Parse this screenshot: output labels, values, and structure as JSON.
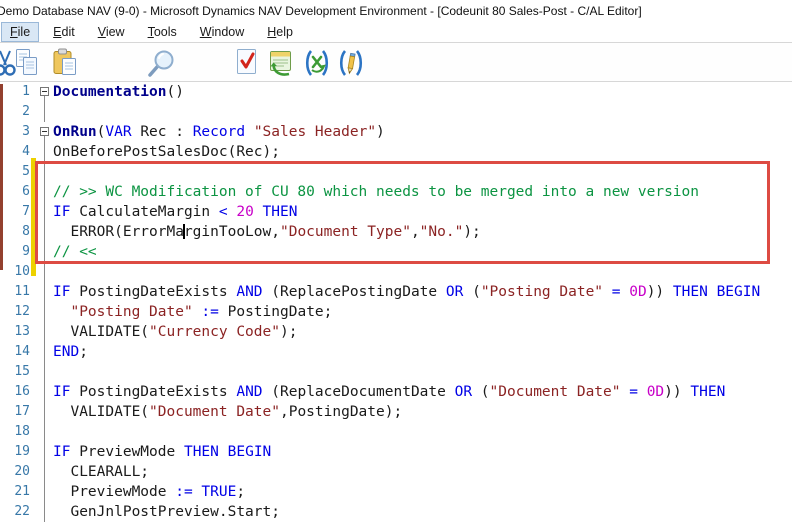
{
  "window": {
    "title": "Demo Database NAV (9-0) - Microsoft Dynamics NAV Development Environment - [Codeunit 80 Sales-Post - C/AL Editor]"
  },
  "menu": {
    "items": [
      {
        "label": "File",
        "mnemonic": "F",
        "active": true
      },
      {
        "label": "Edit",
        "mnemonic": "E",
        "active": false
      },
      {
        "label": "View",
        "mnemonic": "V",
        "active": false
      },
      {
        "label": "Tools",
        "mnemonic": "T",
        "active": false
      },
      {
        "label": "Window",
        "mnemonic": "W",
        "active": false
      },
      {
        "label": "Help",
        "mnemonic": "H",
        "active": false
      }
    ]
  },
  "toolbar": {
    "buttons": [
      "cut",
      "copy",
      "paste",
      "find",
      "compile",
      "run",
      "cal-symbol-menu",
      "cal-locals"
    ]
  },
  "editor": {
    "syntax_colors": {
      "keyword": "#0000e6",
      "trigger": "#00008b",
      "string": "#8b2323",
      "comment": "#0c9442",
      "number": "#c800c8",
      "plain": "#1a1a1a",
      "line_number": "#3878a8"
    },
    "annotations": {
      "highlight_box": {
        "color": "#dd4b43",
        "lines_covered": "5-10"
      },
      "changed_lines_bar": {
        "color": "#edd100",
        "lines_covered": "5-10"
      },
      "left_edge_strip": {
        "color": "#93402f"
      },
      "caret": {
        "line": 8,
        "after_text": "ERROR(ErrorMa"
      }
    },
    "lines": [
      {
        "n": 1,
        "fold": "box",
        "seg": [
          [
            "tr",
            "Documentation"
          ],
          [
            "pl",
            "()"
          ]
        ]
      },
      {
        "n": 2,
        "fold": "bar",
        "seg": []
      },
      {
        "n": 3,
        "fold": "box",
        "seg": [
          [
            "tr",
            "OnRun"
          ],
          [
            "pl",
            "("
          ],
          [
            "kw",
            "VAR"
          ],
          [
            "pl",
            " Rec : "
          ],
          [
            "kw",
            "Record"
          ],
          [
            "pl",
            " "
          ],
          [
            "st",
            "\"Sales Header\""
          ],
          [
            "pl",
            ")"
          ]
        ]
      },
      {
        "n": 4,
        "fold": "bar",
        "seg": [
          [
            "pl",
            "OnBeforePostSalesDoc(Rec);"
          ]
        ]
      },
      {
        "n": 5,
        "fold": "bar",
        "seg": []
      },
      {
        "n": 6,
        "fold": "bar",
        "seg": [
          [
            "cm",
            "// >> WC Modification of CU 80 which needs to be merged into a new version"
          ]
        ]
      },
      {
        "n": 7,
        "fold": "bar",
        "seg": [
          [
            "kw",
            "IF"
          ],
          [
            "pl",
            " CalculateMargin "
          ],
          [
            "kw",
            "<"
          ],
          [
            "pl",
            " "
          ],
          [
            "nm",
            "20"
          ],
          [
            "pl",
            " "
          ],
          [
            "kw",
            "THEN"
          ]
        ]
      },
      {
        "n": 8,
        "fold": "bar",
        "seg": [
          [
            "pl",
            "  ERROR(ErrorMa"
          ],
          [
            "cr",
            ""
          ],
          [
            "pl",
            "rginTooLow,"
          ],
          [
            "st",
            "\"Document Type\""
          ],
          [
            "pl",
            ","
          ],
          [
            "st",
            "\"No.\""
          ],
          [
            "pl",
            ");"
          ]
        ]
      },
      {
        "n": 9,
        "fold": "bar",
        "seg": [
          [
            "cm",
            "// <<"
          ]
        ]
      },
      {
        "n": 10,
        "fold": "bar",
        "seg": []
      },
      {
        "n": 11,
        "fold": "bar",
        "seg": [
          [
            "kw",
            "IF"
          ],
          [
            "pl",
            " PostingDateExists "
          ],
          [
            "kw",
            "AND"
          ],
          [
            "pl",
            " (ReplacePostingDate "
          ],
          [
            "kw",
            "OR"
          ],
          [
            "pl",
            " ("
          ],
          [
            "st",
            "\"Posting Date\""
          ],
          [
            "pl",
            " "
          ],
          [
            "kw",
            "="
          ],
          [
            "pl",
            " "
          ],
          [
            "nm",
            "0D"
          ],
          [
            "pl",
            ")) "
          ],
          [
            "kw",
            "THEN"
          ],
          [
            "pl",
            " "
          ],
          [
            "kw",
            "BEGIN"
          ]
        ]
      },
      {
        "n": 12,
        "fold": "bar",
        "seg": [
          [
            "pl",
            "  "
          ],
          [
            "st",
            "\"Posting Date\""
          ],
          [
            "pl",
            " "
          ],
          [
            "kw",
            ":="
          ],
          [
            "pl",
            " PostingDate;"
          ]
        ]
      },
      {
        "n": 13,
        "fold": "bar",
        "seg": [
          [
            "pl",
            "  VALIDATE("
          ],
          [
            "st",
            "\"Currency Code\""
          ],
          [
            "pl",
            ");"
          ]
        ]
      },
      {
        "n": 14,
        "fold": "bar",
        "seg": [
          [
            "kw",
            "END"
          ],
          [
            "pl",
            ";"
          ]
        ]
      },
      {
        "n": 15,
        "fold": "bar",
        "seg": []
      },
      {
        "n": 16,
        "fold": "bar",
        "seg": [
          [
            "kw",
            "IF"
          ],
          [
            "pl",
            " PostingDateExists "
          ],
          [
            "kw",
            "AND"
          ],
          [
            "pl",
            " (ReplaceDocumentDate "
          ],
          [
            "kw",
            "OR"
          ],
          [
            "pl",
            " ("
          ],
          [
            "st",
            "\"Document Date\""
          ],
          [
            "pl",
            " "
          ],
          [
            "kw",
            "="
          ],
          [
            "pl",
            " "
          ],
          [
            "nm",
            "0D"
          ],
          [
            "pl",
            ")) "
          ],
          [
            "kw",
            "THEN"
          ]
        ]
      },
      {
        "n": 17,
        "fold": "bar",
        "seg": [
          [
            "pl",
            "  VALIDATE("
          ],
          [
            "st",
            "\"Document Date\""
          ],
          [
            "pl",
            ",PostingDate);"
          ]
        ]
      },
      {
        "n": 18,
        "fold": "bar",
        "seg": []
      },
      {
        "n": 19,
        "fold": "bar",
        "seg": [
          [
            "kw",
            "IF"
          ],
          [
            "pl",
            " PreviewMode "
          ],
          [
            "kw",
            "THEN"
          ],
          [
            "pl",
            " "
          ],
          [
            "kw",
            "BEGIN"
          ]
        ]
      },
      {
        "n": 20,
        "fold": "bar",
        "seg": [
          [
            "pl",
            "  CLEARALL;"
          ]
        ]
      },
      {
        "n": 21,
        "fold": "bar",
        "seg": [
          [
            "pl",
            "  PreviewMode "
          ],
          [
            "kw",
            ":="
          ],
          [
            "pl",
            " "
          ],
          [
            "kw",
            "TRUE"
          ],
          [
            "pl",
            ";"
          ]
        ]
      },
      {
        "n": 22,
        "fold": "bar",
        "seg": [
          [
            "pl",
            "  GenJnlPostPreview.Start;"
          ]
        ]
      }
    ]
  }
}
